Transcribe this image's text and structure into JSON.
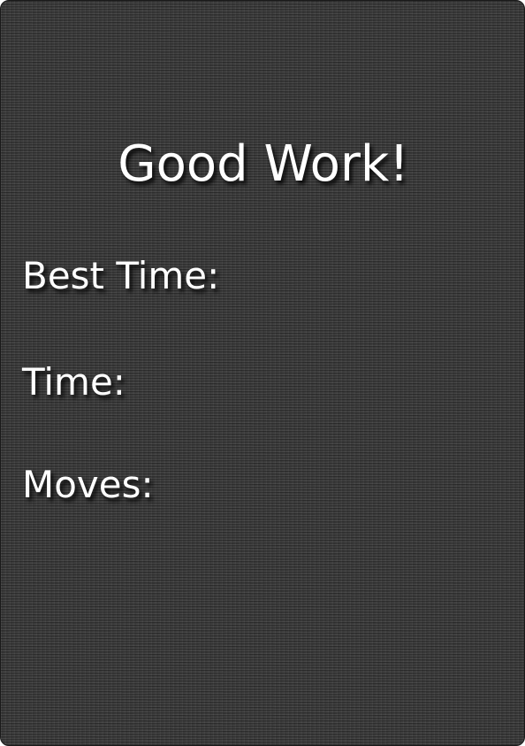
{
  "result": {
    "title": "Good Work!",
    "best_time_label": "Best Time:",
    "best_time_value": "",
    "time_label": "Time:",
    "time_value": "",
    "moves_label": "Moves:",
    "moves_value": ""
  },
  "colors": {
    "panel_background": "#3c3c3c",
    "text": "#ffffff"
  }
}
